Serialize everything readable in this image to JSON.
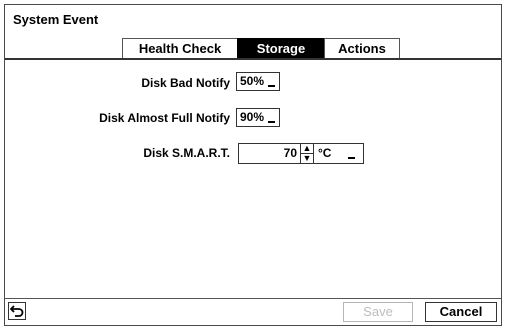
{
  "window": {
    "title": "System Event"
  },
  "tabs": [
    {
      "label": "Health Check",
      "active": false
    },
    {
      "label": "Storage",
      "active": true
    },
    {
      "label": "Actions",
      "active": false
    }
  ],
  "fields": {
    "disk_bad_notify": {
      "label": "Disk Bad Notify",
      "value": "50%"
    },
    "disk_almost_full": {
      "label": "Disk Almost Full Notify",
      "value": "90%"
    },
    "disk_smart": {
      "label": "Disk S.M.A.R.T.",
      "value": "70",
      "unit": "°C"
    }
  },
  "footer": {
    "back_icon": "back-arrow-icon",
    "save_label": "Save",
    "save_enabled": false,
    "cancel_label": "Cancel"
  }
}
